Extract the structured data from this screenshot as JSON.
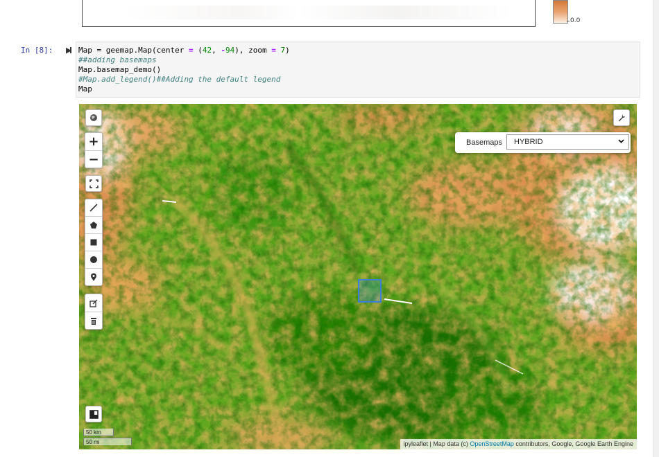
{
  "previous_output": {
    "legend_min_label": "0.0"
  },
  "cell": {
    "prompt": "In [8]:",
    "lines": {
      "l1_a": "Map = geemap.Map(center ",
      "l1_eq": "=",
      "l1_b": " (",
      "l1_n1": "42",
      "l1_c": ", ",
      "l1_minus": "-",
      "l1_n2": "94",
      "l1_d": "), zoom ",
      "l1_eq2": "=",
      "l1_e": " ",
      "l1_n3": "7",
      "l1_f": ")",
      "l2": "##adding basemaps",
      "l3": "Map.basemap_demo()",
      "l4": "#Map.add_legend()##Adding the default legend",
      "l5": "Map"
    }
  },
  "map": {
    "basemaps_label": "Basemaps",
    "basemaps_selected": "HYBRID",
    "scale_km": "50 km",
    "scale_mi": "50 mi",
    "attribution_prefix": "ipyleaflet | Map data (c) ",
    "attribution_link": "OpenStreetMap",
    "attribution_suffix": " contributors, Google, Google Earth Engine"
  },
  "colors": {
    "code_bg": "#f5f5f5",
    "prompt": "#303f9f",
    "number": "#008800",
    "operator": "#aa22ff",
    "comment": "#408080",
    "vegetation_high": "#1e7a00",
    "vegetation_mid": "#6cbf20",
    "vegetation_low": "#e5ad5c",
    "bare": "#d4864a",
    "cloud": "#ffffff"
  },
  "icons": [
    "globe-icon",
    "wrench-icon",
    "zoom-in-icon",
    "zoom-out-icon",
    "fullscreen-icon",
    "polyline-icon",
    "polygon-icon",
    "rectangle-icon",
    "circle-icon",
    "marker-icon",
    "edit-icon",
    "trash-icon",
    "layers-icon",
    "chevron-down-icon"
  ]
}
